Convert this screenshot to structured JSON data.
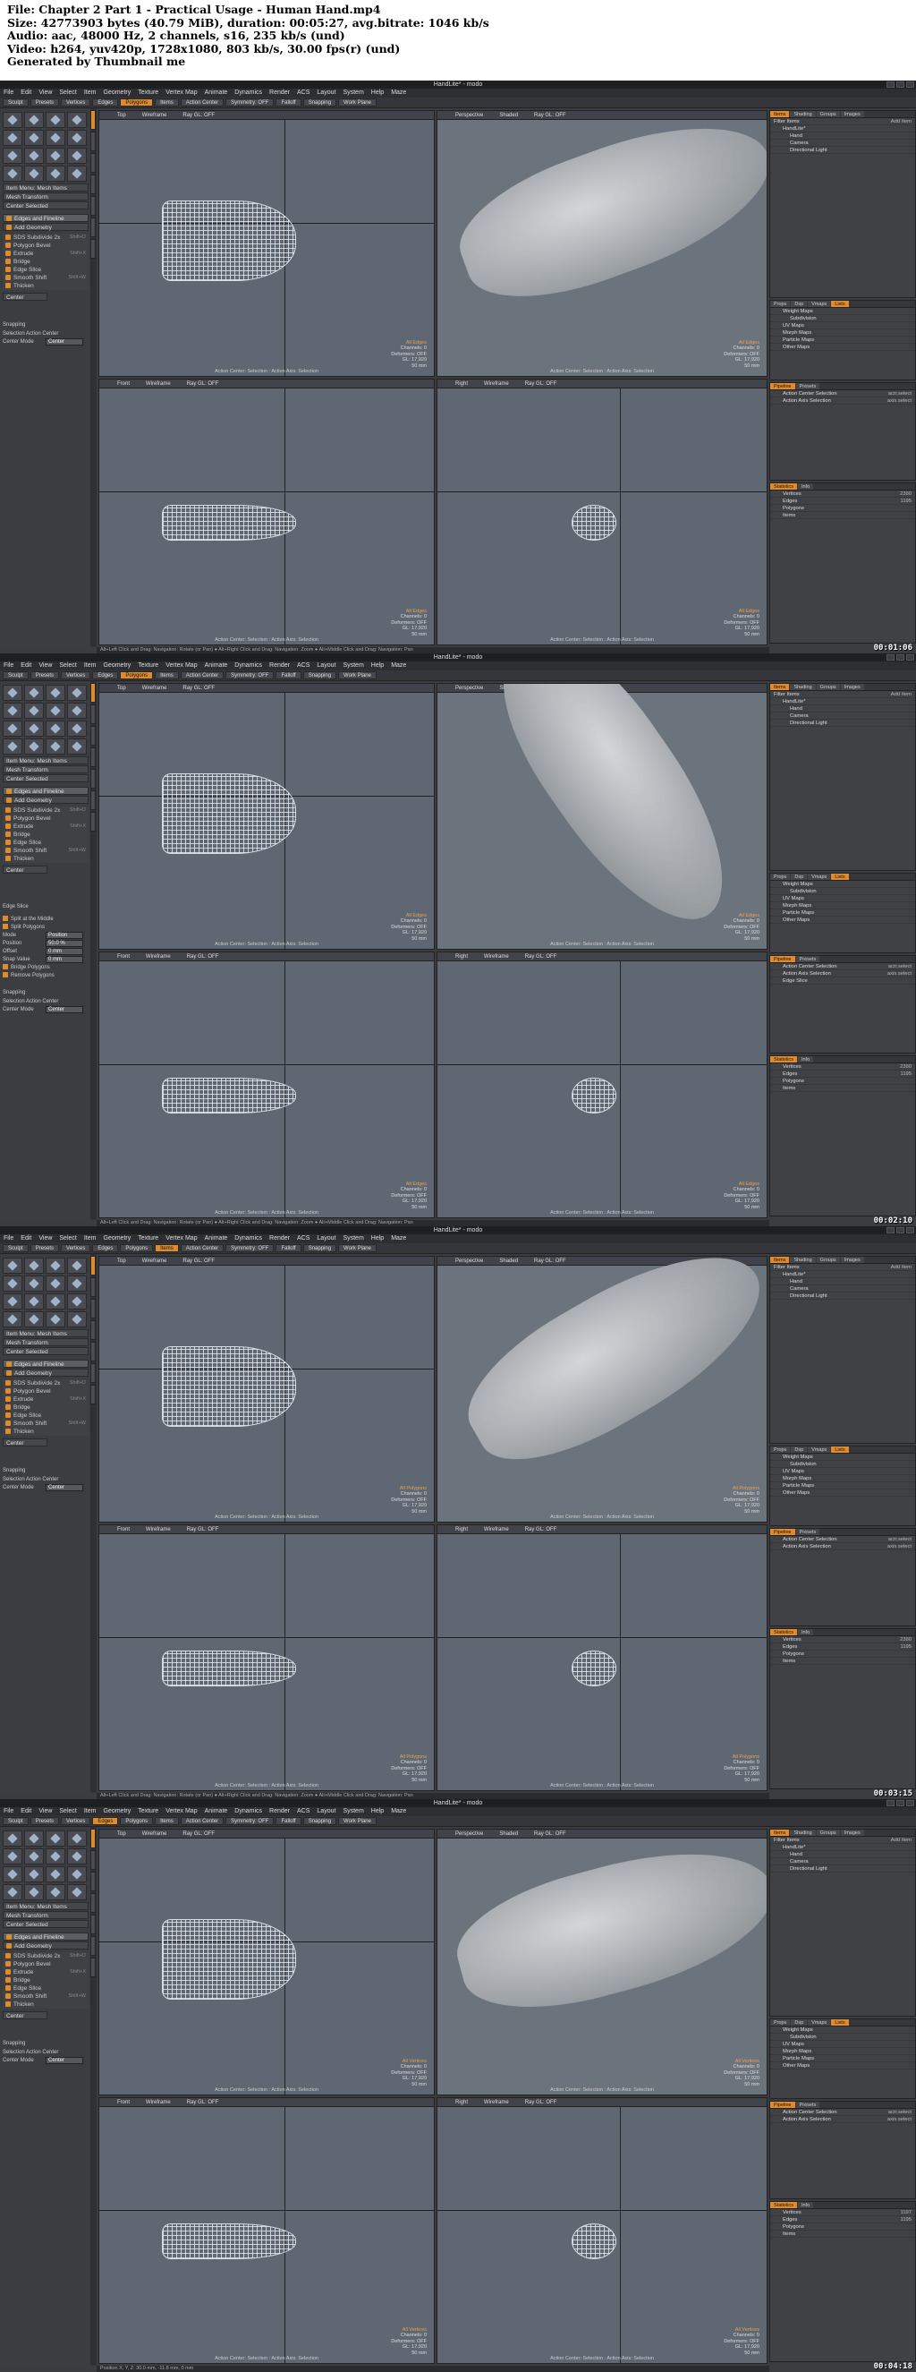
{
  "header": {
    "lines": [
      "File: Chapter 2 Part 1 - Practical Usage - Human Hand.mp4",
      "Size: 42773903 bytes (40.79 MiB), duration: 00:05:27, avg.bitrate: 1046 kb/s",
      "Audio: aac, 48000 Hz, 2 channels, s16, 235 kb/s (und)",
      "Video: h264, yuv420p, 1728x1080, 803 kb/s, 30.00 fps(r) (und)",
      "Generated by Thumbnail me"
    ]
  },
  "app": {
    "title": "HandLite* - modo",
    "menu": [
      "File",
      "Edit",
      "View",
      "Select",
      "Item",
      "Geometry",
      "Texture",
      "Vertex Map",
      "Animate",
      "Dynamics",
      "Render",
      "ACS",
      "Layout",
      "System",
      "Help",
      "Maze"
    ],
    "toolbar": [
      "Sculpt",
      "Presets",
      "Vertices",
      "Edges",
      "Polygons",
      "Items",
      "Action Center",
      "Symmetry: OFF",
      "Falloff",
      "Snapping",
      "Work Plane"
    ],
    "left_rows": [
      "Item Menu: Mesh Items",
      "Mesh Transform",
      "Center Selected",
      "Edges and Fineline",
      "Add Geometry",
      "SDS Subdivide 2x",
      "Polygon Bevel",
      "Extrude",
      "Bridge",
      "Edge Slice",
      "Smooth Shift",
      "Thicken"
    ],
    "left_keys": [
      "",
      "",
      "",
      "",
      "",
      "Shift+D",
      "",
      "Shift+X",
      "",
      "",
      "Shift+W",
      ""
    ],
    "snapping": "Snapping",
    "sel_action": "Selection Action Center",
    "center_mode_label": "Center Mode",
    "center_mode": "Center",
    "edge_slice": {
      "title": "Edge Slice",
      "options": [
        "Split at the Middle",
        "Split Polygons",
        "Mode",
        "Position",
        "Offset",
        "Snap Value",
        "Bridge Polygons",
        "Remove Polygons"
      ],
      "values": [
        "",
        "",
        "Position",
        "50.0 %",
        "0 mm",
        "0 mm",
        "",
        ""
      ]
    },
    "viewports": {
      "top": "Top",
      "wireframe": "Wireframe",
      "perspective": "Perspective",
      "shaded": "Shaded",
      "front": "Front",
      "right": "Right",
      "ray_gl": "Ray GL: OFF",
      "status_line": "Action Center: Selection : Action Axis: Selection"
    },
    "statusbar": "Alt+Left Click and Drag: Navigation: Rotate (or Pan) ● Alt+Right Click and Drag: Navigation: Zoom ● Alt+Middle Click and Drag: Navigation: Pan",
    "statusbar_last": "Position X, Y, Z: 30.0 mm, -11.8 mm, 0 mm",
    "right": {
      "tabs": [
        "Items",
        "Shading",
        "Groups",
        "Images"
      ],
      "filter": "Filter Items",
      "add_item": "Add Item",
      "items": [
        "HandLite*",
        "Hand",
        "Camera",
        "Directional Light"
      ],
      "vm_tabs": [
        "Props",
        "Dsp",
        "Vmaps",
        "Lists"
      ],
      "vmaps": [
        "Weight Maps",
        "Subdivision",
        "UV Maps",
        "Morph Maps",
        "Particle Maps",
        "Other Maps"
      ],
      "pipe_tabs": [
        "Pipeline",
        "Presets"
      ],
      "pipe": [
        "Action Center Selection",
        "Action Axis Selection",
        "Edge Slice"
      ],
      "pipe_vals": [
        "actr.select",
        "axis.select",
        ""
      ],
      "stat_tabs": [
        "Statistics",
        "Info"
      ],
      "stats": [
        "Vertices",
        "Edges",
        "Polygons",
        "Items"
      ]
    }
  },
  "frames": [
    {
      "timestamp": "00:01:06",
      "mode": "Edges",
      "stats": [
        "All Edges",
        "Channels: 0",
        "Deformers: OFF",
        "GL: 17,920",
        "50 mm"
      ],
      "row1": "2390",
      "row2": "1195",
      "slice": false,
      "tool": 4
    },
    {
      "timestamp": "00:02:10",
      "mode": "Edges",
      "stats": [
        "All Edges",
        "Channels: 0",
        "Deformers: OFF",
        "GL: 17,920",
        "50 mm"
      ],
      "row1": "2390",
      "row2": "1195",
      "slice": true,
      "tool": 4
    },
    {
      "timestamp": "00:03:15",
      "mode": "Polygons",
      "stats": [
        "All Polygons",
        "Channels: 0",
        "Deformers: OFF",
        "GL: 17,920",
        "50 mm"
      ],
      "row1": "2390",
      "row2": "1195",
      "slice": false,
      "tool": 5
    },
    {
      "timestamp": "00:04:18",
      "mode": "Vertices",
      "stats": [
        "All Vertices",
        "Channels: 0",
        "Deformers: OFF",
        "GL: 17,920",
        "50 mm"
      ],
      "row1": "1197",
      "row2": "1195",
      "slice": false,
      "tool": 3
    }
  ],
  "colors": {
    "accent": "#e08a2e",
    "viewport": "#5f6872",
    "panel": "#3b3d41"
  }
}
